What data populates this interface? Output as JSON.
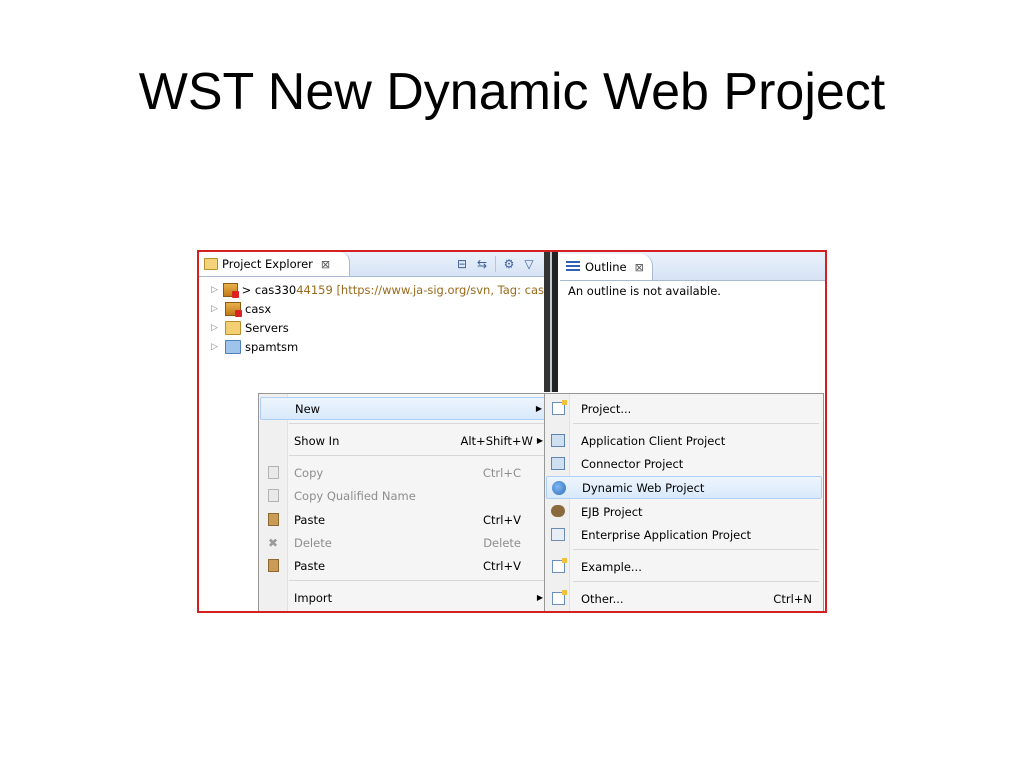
{
  "slide": {
    "title": "WST New Dynamic Web Project"
  },
  "project_explorer": {
    "tab_label": "Project Explorer",
    "close_glyph": "⊠",
    "tree": [
      {
        "icon": "project-icon",
        "prefix": "> cas330",
        "repo": " 44159 [https://www.ja-sig.org/svn, Tag: cas"
      },
      {
        "icon": "project-icon",
        "prefix": "casx",
        "repo": ""
      },
      {
        "icon": "folder-icon",
        "prefix": "Servers",
        "repo": ""
      },
      {
        "icon": "folder-icon",
        "prefix": "spamtsm",
        "repo": ""
      }
    ]
  },
  "outline": {
    "tab_label": "Outline",
    "close_glyph": "⊠",
    "message": "An outline is not available."
  },
  "context_menu": {
    "items": [
      {
        "label": "New",
        "shortcut": "",
        "submenu": true,
        "disabled": false,
        "icon": ""
      },
      {
        "label": "Show In",
        "shortcut": "Alt+Shift+W",
        "submenu": true,
        "disabled": false,
        "icon": ""
      },
      {
        "label": "Copy",
        "shortcut": "Ctrl+C",
        "submenu": false,
        "disabled": true,
        "icon": "copy-icon"
      },
      {
        "label": "Copy Qualified Name",
        "shortcut": "",
        "submenu": false,
        "disabled": true,
        "icon": "copy-qualified-icon"
      },
      {
        "label": "Paste",
        "shortcut": "Ctrl+V",
        "submenu": false,
        "disabled": false,
        "icon": "paste-icon"
      },
      {
        "label": "Delete",
        "shortcut": "Delete",
        "submenu": false,
        "disabled": true,
        "icon": "delete-icon"
      },
      {
        "label": "Paste",
        "shortcut": "Ctrl+V",
        "submenu": false,
        "disabled": false,
        "icon": "paste-icon"
      },
      {
        "label": "Import",
        "shortcut": "",
        "submenu": true,
        "disabled": false,
        "icon": ""
      }
    ]
  },
  "new_submenu": {
    "items": [
      {
        "label": "Project...",
        "shortcut": ""
      },
      {
        "label": "Application Client Project",
        "shortcut": ""
      },
      {
        "label": "Connector Project",
        "shortcut": ""
      },
      {
        "label": "Dynamic Web Project",
        "shortcut": ""
      },
      {
        "label": "EJB Project",
        "shortcut": ""
      },
      {
        "label": "Enterprise Application Project",
        "shortcut": ""
      },
      {
        "label": "Example...",
        "shortcut": ""
      },
      {
        "label": "Other...",
        "shortcut": "Ctrl+N"
      }
    ]
  },
  "colors": {
    "frame_border": "#d42020",
    "highlight": "#d9e9fb",
    "disabled_text": "#8d8d8d"
  }
}
